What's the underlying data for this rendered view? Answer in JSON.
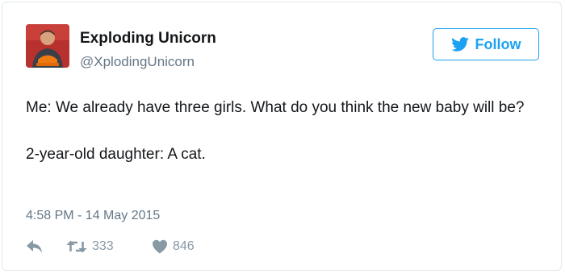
{
  "tweet": {
    "display_name": "Exploding Unicorn",
    "handle": "@XplodingUnicorn",
    "follow_label": "Follow",
    "text_paragraphs": [
      "Me: We already have three girls. What do you think the new baby will be?",
      "2-year-old daughter: A cat."
    ],
    "timestamp": "4:58 PM - 14 May 2015",
    "retweet_count": "333",
    "like_count": "846"
  },
  "icons": {
    "avatar": "avatar-photo",
    "follow": "twitter-bird-icon",
    "reply": "reply-icon",
    "retweet": "retweet-icon",
    "like": "heart-icon"
  },
  "colors": {
    "accent": "#1da1f2",
    "secondary_text": "#657786",
    "action_icon": "#8899a6",
    "border": "#e1e8ed"
  }
}
